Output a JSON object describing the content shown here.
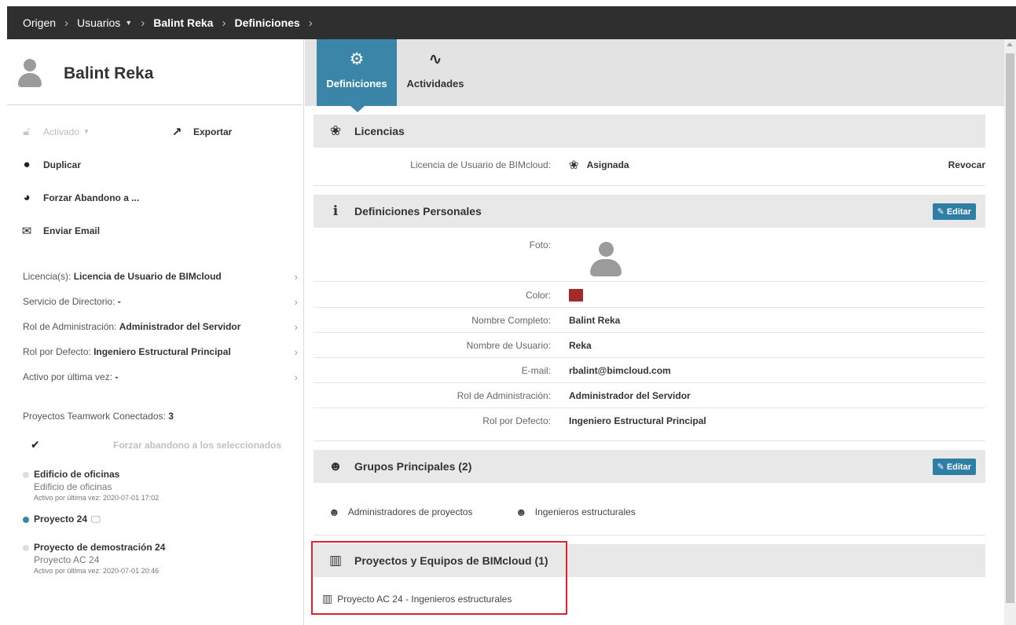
{
  "breadcrumb": {
    "items": [
      "Origen",
      "Usuarios",
      "Balint Reka",
      "Definiciones"
    ]
  },
  "user": {
    "name": "Balint Reka"
  },
  "actions": {
    "activated": "Activado",
    "export": "Exportar",
    "duplicate": "Duplicar",
    "force_release": "Forzar Abandono a ...",
    "send_email": "Enviar Email"
  },
  "info": {
    "license_label": "Licencia(s):",
    "license_value": "Licencia de Usuario de BIMcloud",
    "directory_label": "Servicio de Directorio:",
    "directory_value": "-",
    "admin_role_label": "Rol de Administración:",
    "admin_role_value": "Administrador del Servidor",
    "default_role_label": "Rol por Defecto:",
    "default_role_value": "Ingeniero Estructural Principal",
    "last_active_label": "Activo por última vez:",
    "last_active_value": "-"
  },
  "projects": {
    "connected_label": "Proyectos Teamwork Conectados:",
    "connected_count": "3",
    "force_selected": "Forzar abandono a los seleccionados",
    "items": [
      {
        "name": "Edificio de oficinas",
        "sub": "Edificio de oficinas",
        "date": "Activo por última vez: 2020-07-01 17:02"
      },
      {
        "name": "Proyecto 24"
      },
      {
        "name": "Proyecto de demostración 24",
        "sub": "Proyecto AC 24",
        "date": "Activo por última vez: 2020-07-01 20:46"
      }
    ]
  },
  "tabs": {
    "settings": "Definiciones",
    "activities": "Actividades"
  },
  "licenses": {
    "title": "Licencias",
    "row_label": "Licencia de Usuario de BIMcloud:",
    "row_value": "Asignada",
    "revoke": "Revocar"
  },
  "personal": {
    "title": "Definiciones Personales",
    "edit": "Editar",
    "photo_label": "Foto:",
    "color_label": "Color:",
    "color_value": "#a32a2a",
    "fullname_label": "Nombre Completo:",
    "fullname_value": "Balint Reka",
    "username_label": "Nombre de Usuario:",
    "username_value": "Reka",
    "email_label": "E-mail:",
    "email_value": "rbalint@bimcloud.com",
    "admin_role_label": "Rol de Administración:",
    "admin_role_value": "Administrador del Servidor",
    "default_role_label": "Rol por Defecto:",
    "default_role_value": "Ingeniero Estructural Principal"
  },
  "groups": {
    "title": "Grupos Principales (2)",
    "edit": "Editar",
    "items": [
      "Administradores de proyectos",
      "Ingenieros estructurales"
    ]
  },
  "teams": {
    "title": "Proyectos y Equipos de BIMcloud (1)",
    "items": [
      "Proyecto AC 24 - Ingenieros estructurales"
    ]
  }
}
